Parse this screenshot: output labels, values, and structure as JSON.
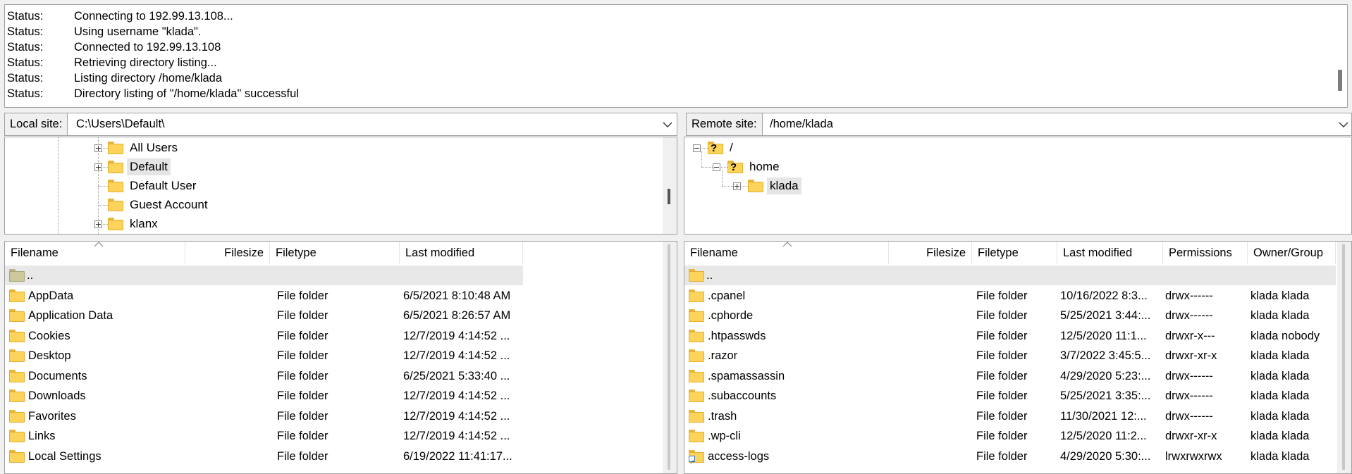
{
  "message_log": [
    {
      "type": "Status:",
      "message": "Connecting to 192.99.13.108..."
    },
    {
      "type": "Status:",
      "message": "Using username \"klada\"."
    },
    {
      "type": "Status:",
      "message": "Connected to 192.99.13.108"
    },
    {
      "type": "Status:",
      "message": "Retrieving directory listing..."
    },
    {
      "type": "Status:",
      "message": "Listing directory /home/klada"
    },
    {
      "type": "Status:",
      "message": "Directory listing of \"/home/klada\" successful"
    }
  ],
  "local": {
    "site_label": "Local site:",
    "path": "C:\\Users\\Default\\",
    "tree": [
      {
        "label": "All Users",
        "expander": "plus"
      },
      {
        "label": "Default",
        "expander": "plus",
        "selected": true
      },
      {
        "label": "Default User",
        "expander": "none"
      },
      {
        "label": "Guest Account",
        "expander": "none"
      },
      {
        "label": "klanx",
        "expander": "plus"
      }
    ],
    "columns": {
      "filename": "Filename",
      "filesize": "Filesize",
      "filetype": "Filetype",
      "last_modified": "Last modified"
    },
    "files": [
      {
        "name": "..",
        "type": "",
        "modified": ""
      },
      {
        "name": "AppData",
        "type": "File folder",
        "modified": "6/5/2021 8:10:48 AM"
      },
      {
        "name": "Application Data",
        "type": "File folder",
        "modified": "6/5/2021 8:26:57 AM"
      },
      {
        "name": "Cookies",
        "type": "File folder",
        "modified": "12/7/2019 4:14:52 ..."
      },
      {
        "name": "Desktop",
        "type": "File folder",
        "modified": "12/7/2019 4:14:52 ..."
      },
      {
        "name": "Documents",
        "type": "File folder",
        "modified": "6/25/2021 5:33:40 ..."
      },
      {
        "name": "Downloads",
        "type": "File folder",
        "modified": "12/7/2019 4:14:52 ..."
      },
      {
        "name": "Favorites",
        "type": "File folder",
        "modified": "12/7/2019 4:14:52 ..."
      },
      {
        "name": "Links",
        "type": "File folder",
        "modified": "12/7/2019 4:14:52 ..."
      },
      {
        "name": "Local Settings",
        "type": "File folder",
        "modified": "6/19/2022 11:41:17..."
      }
    ]
  },
  "remote": {
    "site_label": "Remote site:",
    "path": "/home/klada",
    "tree": [
      {
        "label": "/",
        "expander": "minus",
        "unknown": true
      },
      {
        "label": "home",
        "expander": "minus",
        "unknown": true
      },
      {
        "label": "klada",
        "expander": "plus",
        "selected": true
      }
    ],
    "columns": {
      "filename": "Filename",
      "filesize": "Filesize",
      "filetype": "Filetype",
      "last_modified": "Last modified",
      "permissions": "Permissions",
      "owner_group": "Owner/Group"
    },
    "files": [
      {
        "name": "..",
        "type": "",
        "modified": "",
        "permissions": "",
        "owner": ""
      },
      {
        "name": ".cpanel",
        "type": "File folder",
        "modified": "10/16/2022 8:3...",
        "permissions": "drwx------",
        "owner": "klada klada"
      },
      {
        "name": ".cphorde",
        "type": "File folder",
        "modified": "5/25/2021 3:44:...",
        "permissions": "drwx------",
        "owner": "klada klada"
      },
      {
        "name": ".htpasswds",
        "type": "File folder",
        "modified": "12/5/2020 11:1...",
        "permissions": "drwxr-x---",
        "owner": "klada nobody"
      },
      {
        "name": ".razor",
        "type": "File folder",
        "modified": "3/7/2022 3:45:5...",
        "permissions": "drwxr-xr-x",
        "owner": "klada klada"
      },
      {
        "name": ".spamassassin",
        "type": "File folder",
        "modified": "4/29/2020 5:23:...",
        "permissions": "drwx------",
        "owner": "klada klada"
      },
      {
        "name": ".subaccounts",
        "type": "File folder",
        "modified": "5/25/2021 3:35:...",
        "permissions": "drwx------",
        "owner": "klada klada"
      },
      {
        "name": ".trash",
        "type": "File folder",
        "modified": "11/30/2021 12:...",
        "permissions": "drwx------",
        "owner": "klada klada"
      },
      {
        "name": ".wp-cli",
        "type": "File folder",
        "modified": "12/5/2020 11:2...",
        "permissions": "drwxr-xr-x",
        "owner": "klada klada"
      },
      {
        "name": "access-logs",
        "type": "File folder",
        "modified": "4/29/2020 5:30:...",
        "permissions": "lrwxrwxrwx",
        "owner": "klada klada",
        "shortcut": true
      }
    ]
  },
  "icons": {
    "folder": "folder-icon",
    "parent_folder": "parent-folder-icon",
    "unknown_folder": "unknown-folder-icon",
    "dropdown": "chevron-down-icon"
  }
}
